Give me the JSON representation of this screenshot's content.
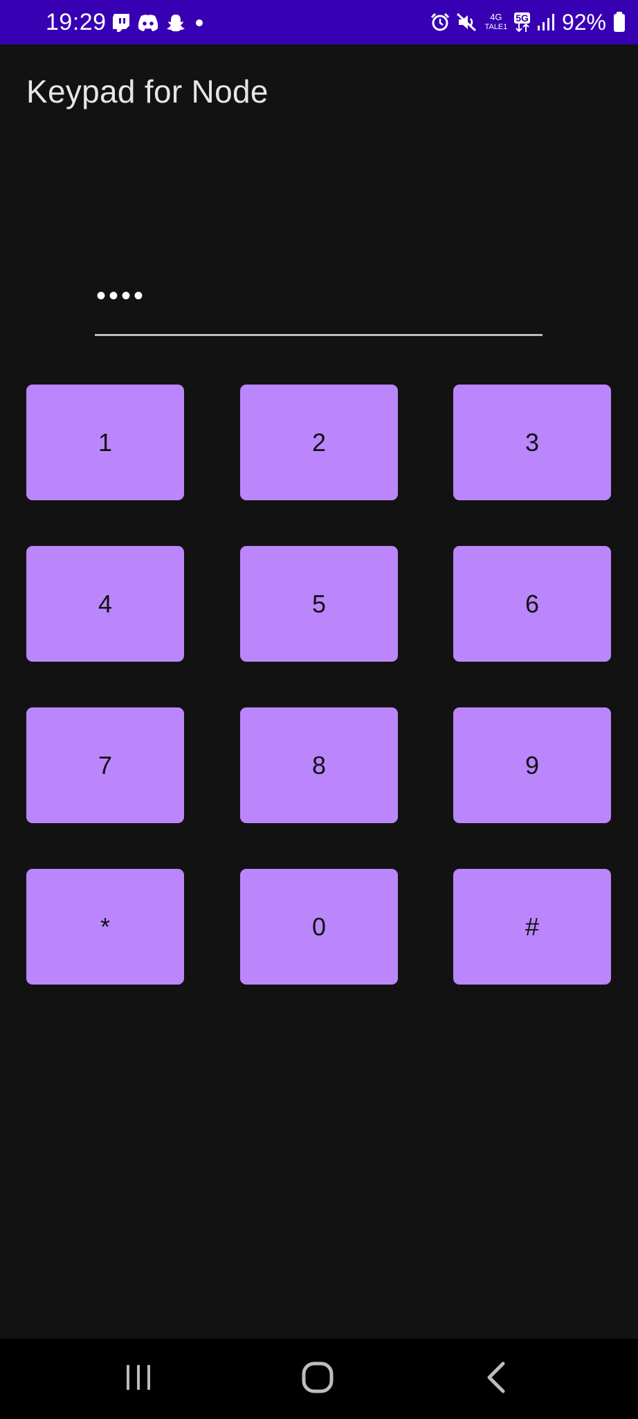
{
  "status_bar": {
    "time": "19:29",
    "left_icons": [
      "twitch-icon",
      "discord-icon",
      "snapchat-icon",
      "notification-dot-icon"
    ],
    "right_icons": [
      "alarm-icon",
      "mute-icon",
      "4g-icon",
      "5g-icon",
      "signal-icon",
      "battery-icon"
    ],
    "net_4g": "4G",
    "net_4g_sub": "TALE1",
    "net_5g": "5G",
    "battery": "92%",
    "bg_color": "#3700B3"
  },
  "app": {
    "title": "Keypad for Node"
  },
  "pin": {
    "value": "••••"
  },
  "keypad": {
    "key_color": "#BB86FC",
    "keys": [
      "1",
      "2",
      "3",
      "4",
      "5",
      "6",
      "7",
      "8",
      "9",
      "*",
      "0",
      "#"
    ]
  },
  "nav_bar": {
    "items": [
      "recents-icon",
      "home-icon",
      "back-icon"
    ]
  }
}
